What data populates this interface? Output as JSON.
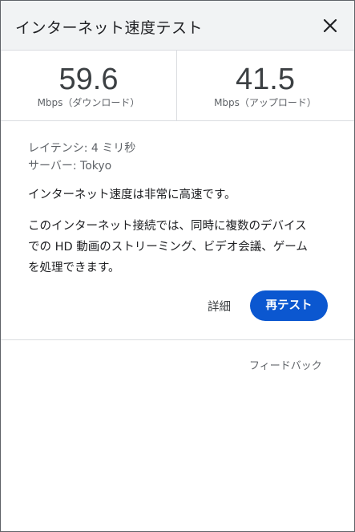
{
  "header": {
    "title": "インターネット速度テスト",
    "close_icon": "close-icon"
  },
  "metrics": {
    "download": {
      "value": "59.6",
      "unit": "Mbps（ダウンロード）"
    },
    "upload": {
      "value": "41.5",
      "unit": "Mbps（アップロード）"
    }
  },
  "info": {
    "latency": "レイテンシ: 4 ミリ秒",
    "server": "サーバー: Tokyo"
  },
  "description": "インターネット速度は非常に高速です。",
  "detail_lines": [
    "このインターネット接続では、同時に複数のデバイス",
    "での HD 動画のストリーミング、ビデオ会議、ゲーム",
    "を処理できます。"
  ],
  "actions": {
    "details": "詳細",
    "retest": "再テスト"
  },
  "footer": {
    "feedback": "フィードバック"
  },
  "colors": {
    "primary": "#0b57d0",
    "header_bg": "#f1f3f4",
    "divider": "#dadce0"
  }
}
